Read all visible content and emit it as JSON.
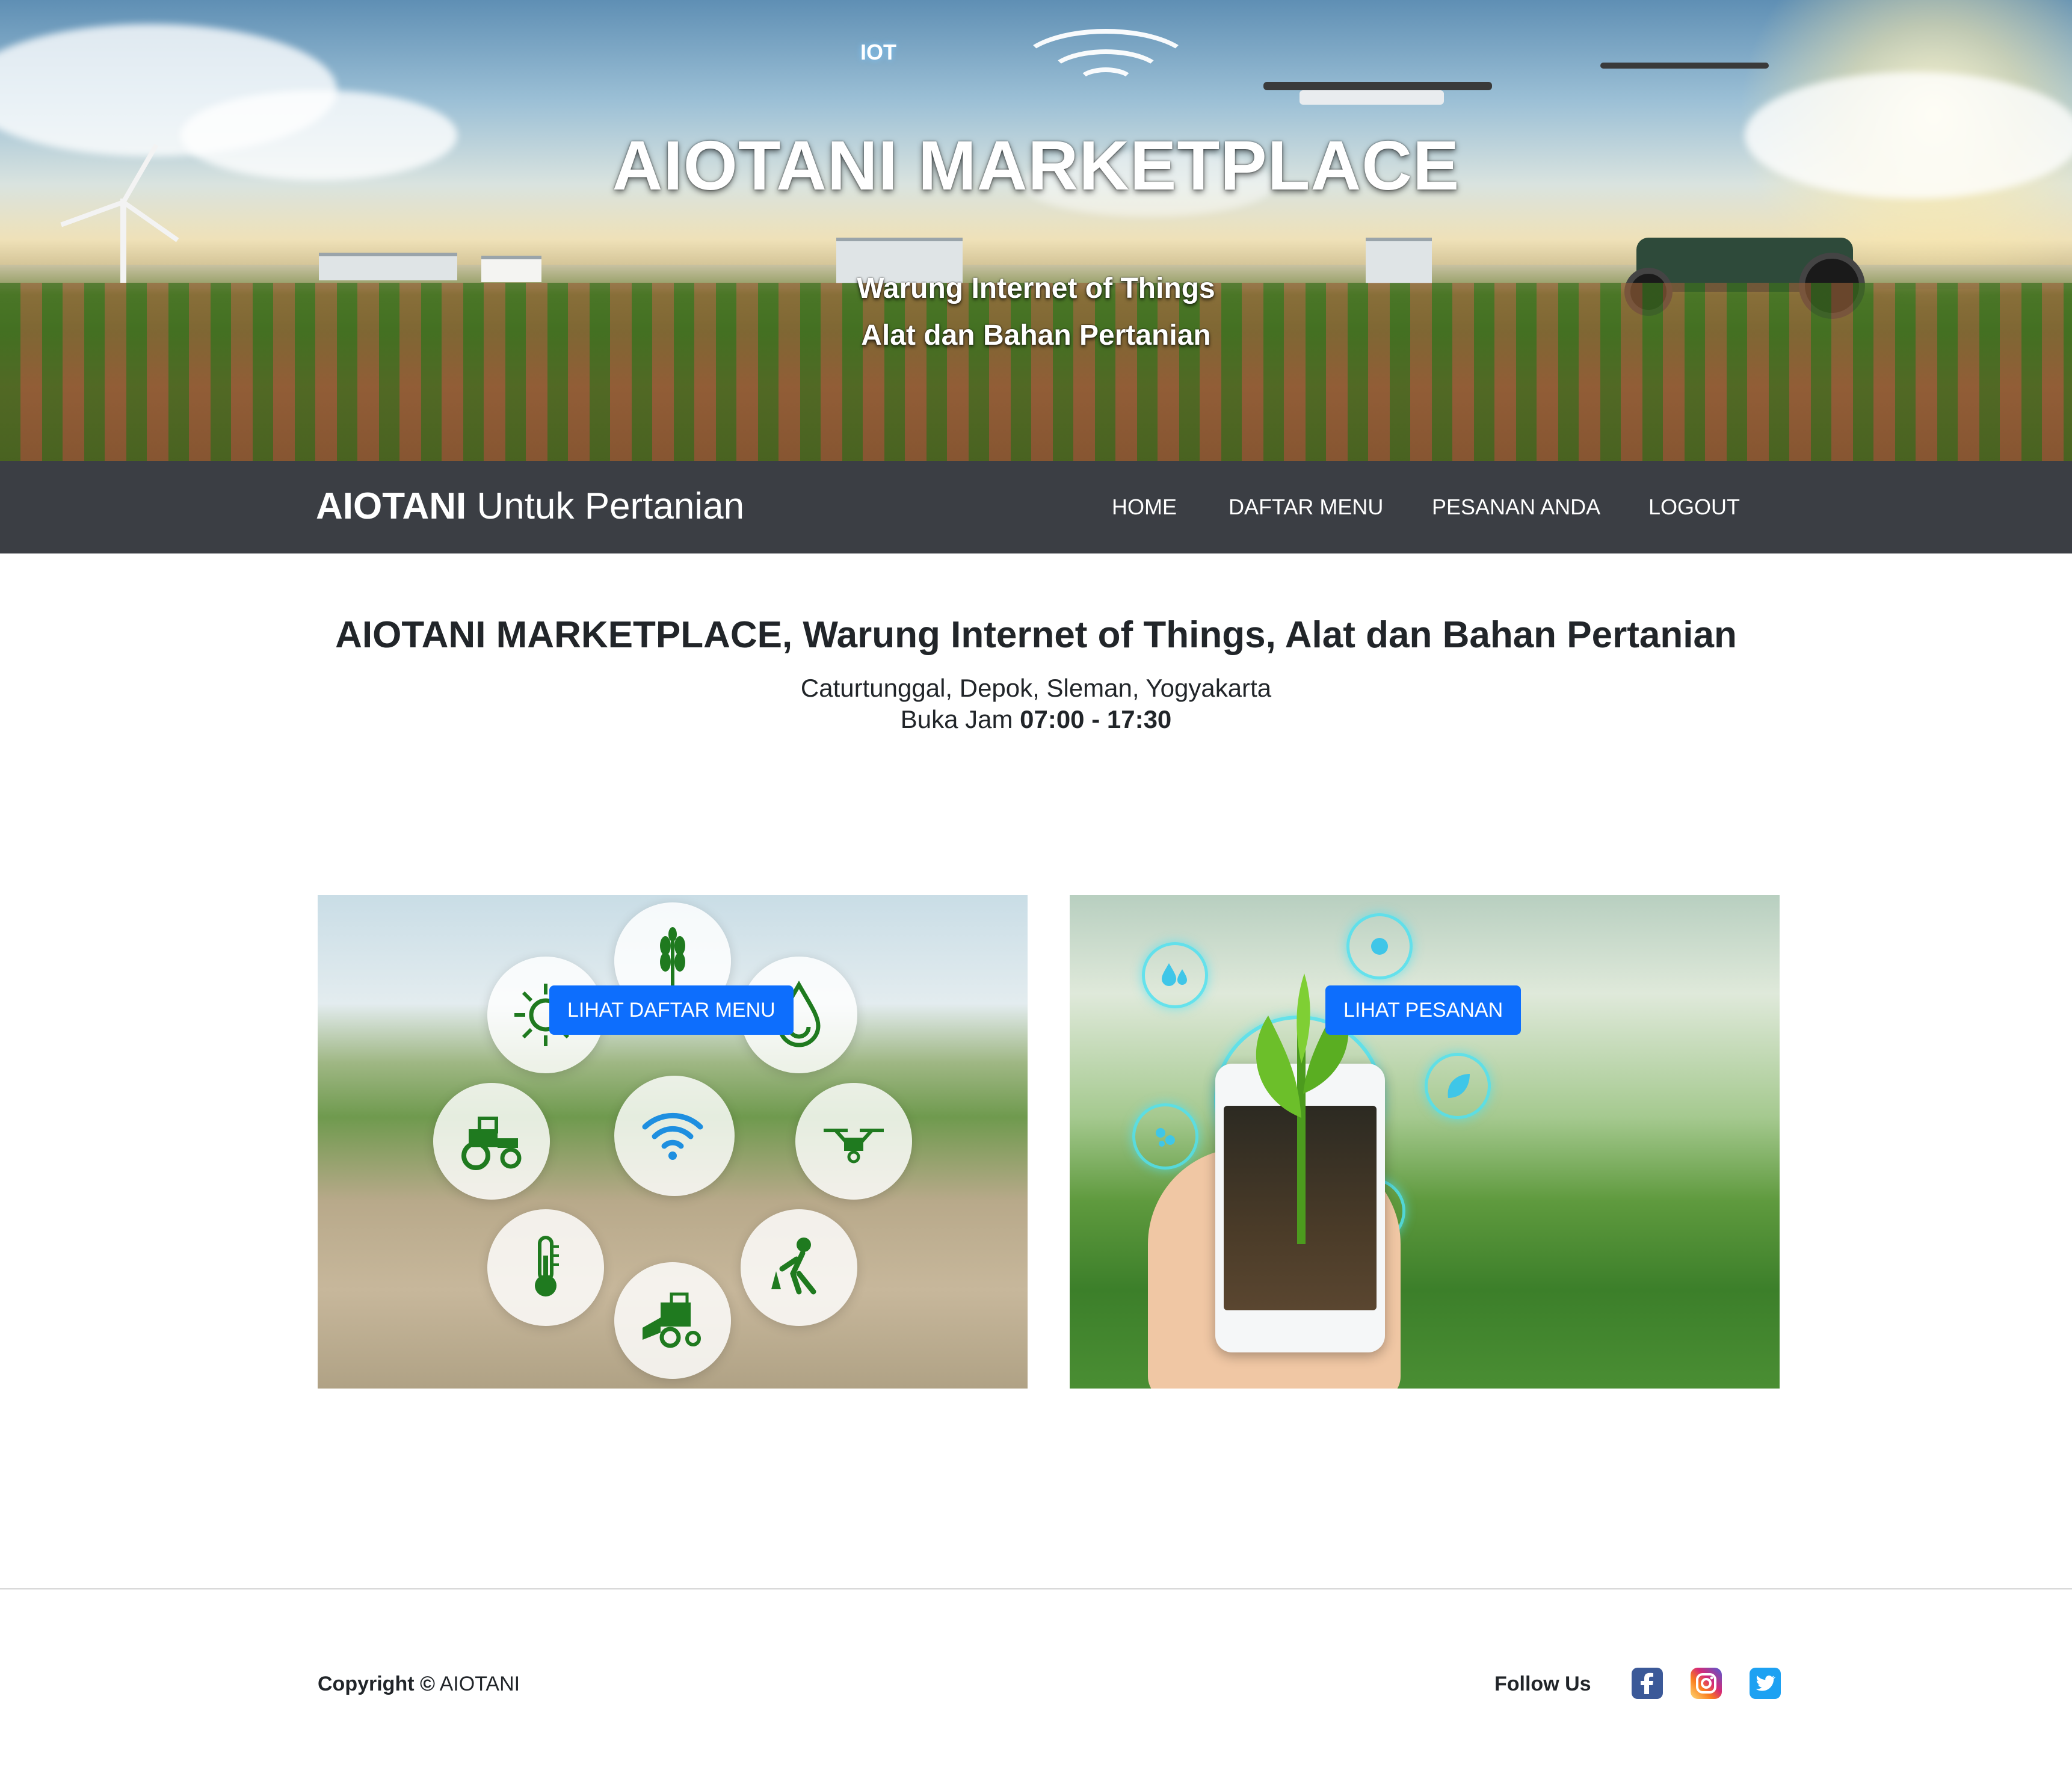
{
  "hero": {
    "iot_badge": "IOT",
    "title": "AIOTANI MARKETPLACE",
    "subtitle_line1": "Warung Internet of Things",
    "subtitle_line2": "Alat dan Bahan Pertanian"
  },
  "navbar": {
    "brand_bold": "AIOTANI",
    "brand_rest": " Untuk Pertanian",
    "links": [
      {
        "label": "HOME"
      },
      {
        "label": "DAFTAR MENU"
      },
      {
        "label": "PESANAN ANDA"
      },
      {
        "label": "LOGOUT"
      }
    ]
  },
  "main": {
    "title": "AIOTANI MARKETPLACE, Warung Internet of Things, Alat dan Bahan Pertanian",
    "address": "Caturtunggal, Depok, Sleman, Yogyakarta",
    "hours_label": "Buka Jam ",
    "hours_value": "07:00 - 17:30"
  },
  "cards": [
    {
      "button_label": "LIHAT DAFTAR MENU",
      "icons": [
        "wheat-icon",
        "sun-icon",
        "water-drop-icon",
        "tractor-icon",
        "wifi-icon",
        "drone-icon",
        "thermometer-icon",
        "harvester-icon",
        "farmer-icon"
      ]
    },
    {
      "button_label": "LIHAT PESANAN",
      "icons": [
        "water-drops-icon",
        "location-icon",
        "phone-plant-icon",
        "leaf-icon",
        "fertilizer-icon",
        "sprinkler-icon"
      ]
    }
  ],
  "footer": {
    "copyright_bold": "Copyright ",
    "copyright_symbol": "©",
    "copyright_name": " AIOTANI",
    "follow_label": "Follow Us",
    "social_icons": [
      "facebook-icon",
      "instagram-icon",
      "twitter-icon"
    ]
  },
  "colors": {
    "navbar_bg": "#3b3e44",
    "button_primary": "#0d6efd",
    "facebook": "#3b5998",
    "twitter": "#1da1f2"
  }
}
